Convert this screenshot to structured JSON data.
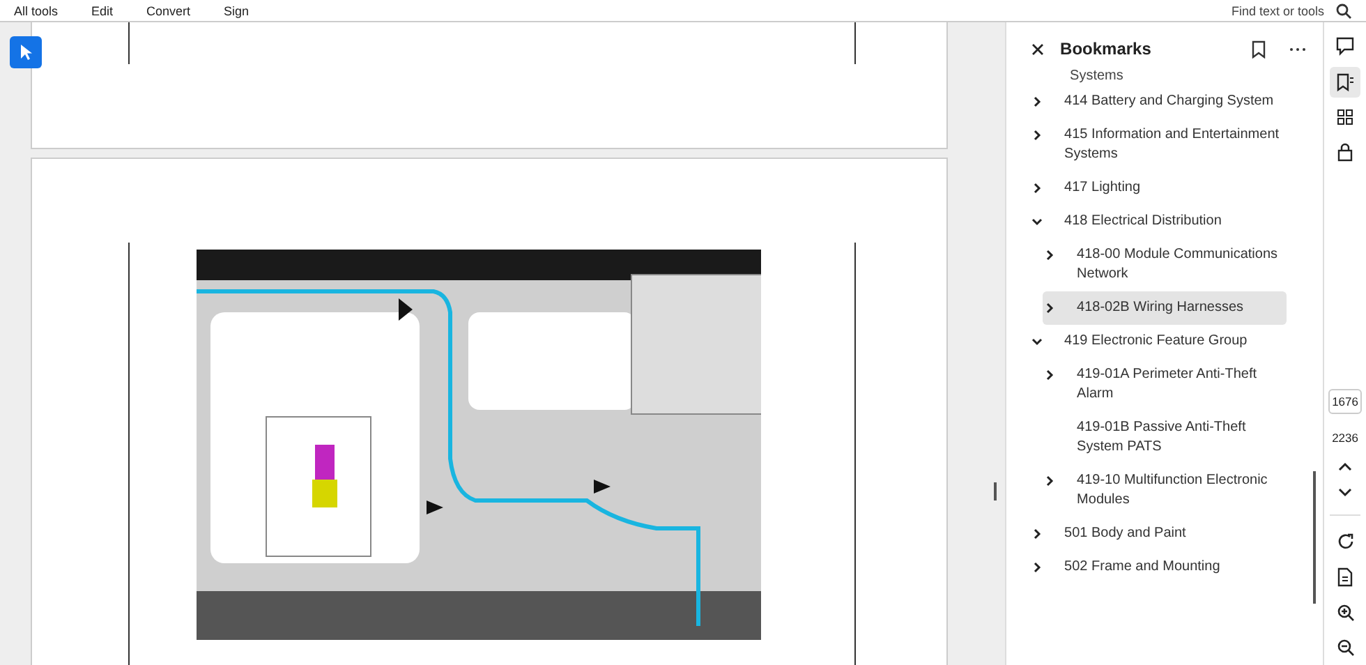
{
  "menu": [
    "All tools",
    "Edit",
    "Convert",
    "Sign"
  ],
  "search": {
    "placeholder": "Find text or tools"
  },
  "bookmarks": {
    "title": "Bookmarks",
    "cut_label": "Systems",
    "items": [
      {
        "label": "414 Battery and Charging System",
        "has_children": true,
        "expanded": false,
        "selected": false
      },
      {
        "label": "415 Information and Entertainment Systems",
        "has_children": true,
        "expanded": false,
        "selected": false
      },
      {
        "label": "417 Lighting",
        "has_children": true,
        "expanded": false,
        "selected": false
      },
      {
        "label": "418 Electrical Distribution",
        "has_children": true,
        "expanded": true,
        "selected": false,
        "children": [
          {
            "label": "418-00 Module Communications Network",
            "has_children": true,
            "expanded": false,
            "selected": false
          },
          {
            "label": "418-02B Wiring Harnesses",
            "has_children": true,
            "expanded": false,
            "selected": true
          }
        ]
      },
      {
        "label": "419 Electronic Feature Group",
        "has_children": true,
        "expanded": true,
        "selected": false,
        "children": [
          {
            "label": "419-01A Perimeter Anti-Theft Alarm",
            "has_children": true,
            "expanded": false,
            "selected": false
          },
          {
            "label": "419-01B Passive Anti-Theft System PATS",
            "has_children": false,
            "selected": false
          },
          {
            "label": "419-10 Multifunction Electronic Modules",
            "has_children": true,
            "expanded": false,
            "selected": false
          }
        ]
      },
      {
        "label": "501 Body and Paint",
        "has_children": true,
        "expanded": false,
        "selected": false
      },
      {
        "label": "502 Frame and Mounting",
        "has_children": true,
        "expanded": false,
        "selected": false
      }
    ]
  },
  "pager": {
    "current": "1676",
    "total": "2236"
  }
}
